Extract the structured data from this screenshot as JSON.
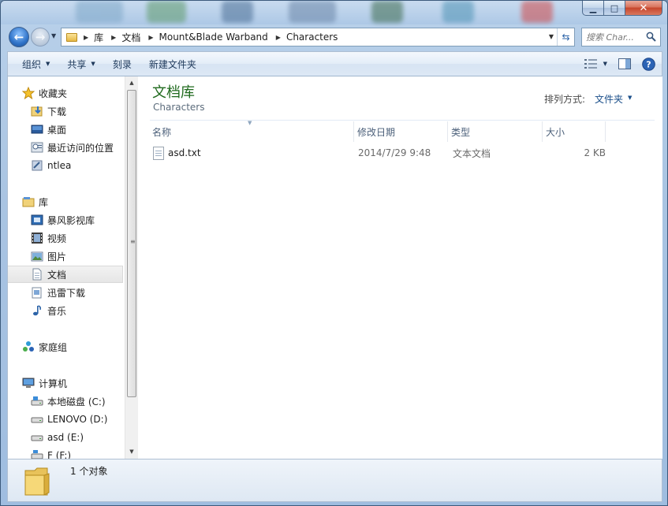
{
  "window": {
    "controls": {
      "minimize": "▁",
      "maximize": "□",
      "close": "✕"
    }
  },
  "address": {
    "crumbs": [
      "库",
      "文档",
      "Mount&Blade Warband",
      "Characters"
    ]
  },
  "search": {
    "placeholder": "搜索 Char..."
  },
  "toolbar": {
    "organize": "组织",
    "share": "共享",
    "burn": "刻录",
    "new_folder": "新建文件夹"
  },
  "nav": {
    "favorites": "收藏夹",
    "downloads": "下载",
    "desktop": "桌面",
    "recent_places": "最近访问的位置",
    "ntlea": "ntlea",
    "libraries": "库",
    "storm_video": "暴风影视库",
    "videos": "视频",
    "pictures": "图片",
    "documents": "文档",
    "thunder_downloads": "迅雷下载",
    "music": "音乐",
    "homegroup": "家庭组",
    "computer": "计算机",
    "drive_c": "本地磁盘 (C:)",
    "drive_d": "LENOVO (D:)",
    "drive_e": "asd (E:)",
    "drive_f": "F (F:)"
  },
  "library": {
    "title": "文档库",
    "subtitle": "Characters",
    "arrange_label": "排列方式:",
    "arrange_value": "文件夹"
  },
  "columns": {
    "name": "名称",
    "modified": "修改日期",
    "type": "类型",
    "size": "大小"
  },
  "files": [
    {
      "name": "asd.txt",
      "modified": "2014/7/29 9:48",
      "type": "文本文档",
      "size": "2 KB"
    }
  ],
  "status": {
    "count": "1 个对象"
  },
  "colors": {
    "library_title": "#1f6a1d",
    "selection_bg": "#e6e6e6",
    "window_frame": "#a9c4e2"
  }
}
